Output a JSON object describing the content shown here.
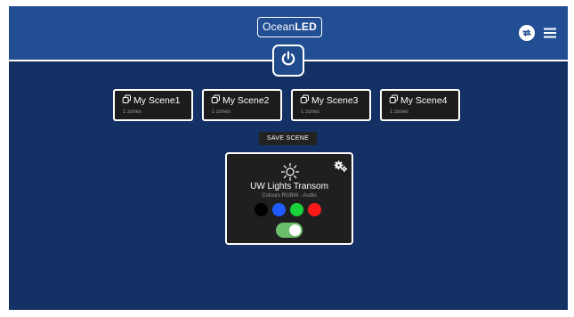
{
  "header": {
    "logo_prefix": "Ocean",
    "logo_suffix": "LED",
    "icons": [
      "power-icon",
      "sync-icon",
      "hamburger-menu-icon"
    ]
  },
  "scenes": [
    {
      "name": "My Scene1",
      "zones": "1 zones"
    },
    {
      "name": "My Scene2",
      "zones": "1 zones"
    },
    {
      "name": "My Scene3",
      "zones": "1 zones"
    },
    {
      "name": "My Scene4",
      "zones": "1 zones"
    }
  ],
  "save_scene_label": "SAVE SCENE",
  "zone": {
    "name": "UW Lights Transom",
    "subtitle": "Colours RGBW - Audio",
    "icons": [
      "sun-icon",
      "settings-gears-icon"
    ],
    "colors": [
      {
        "name": "black",
        "hex": "#000000"
      },
      {
        "name": "blue",
        "hex": "#1e5cff"
      },
      {
        "name": "green",
        "hex": "#19d33a"
      },
      {
        "name": "red",
        "hex": "#ff1a1a"
      }
    ],
    "enabled": true
  },
  "theme": {
    "background": "#133164",
    "header": "#224f94",
    "toggle_on": "#6bbf6a"
  }
}
